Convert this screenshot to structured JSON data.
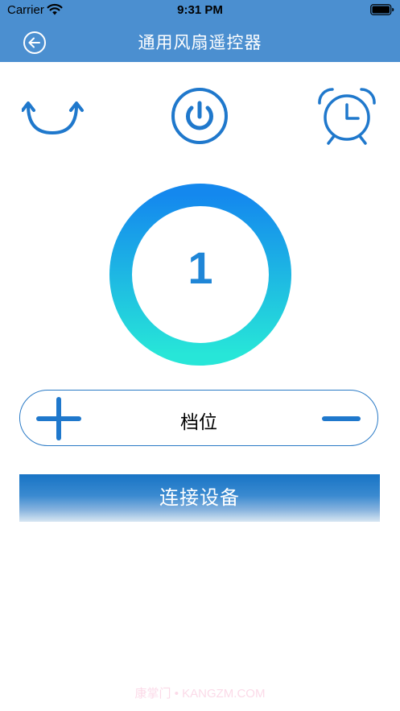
{
  "status_bar": {
    "carrier": "Carrier",
    "time": "9:31 PM"
  },
  "nav": {
    "title": "通用风扇遥控器",
    "back_icon": "back-arrow-circle-icon"
  },
  "controls": {
    "swing_icon": "swing-arrows-icon",
    "power_icon": "power-icon",
    "timer_icon": "alarm-clock-icon"
  },
  "gear": {
    "current_value": "1",
    "label": "档位",
    "plus_icon": "plus-icon",
    "minus_icon": "minus-icon"
  },
  "connect": {
    "label": "连接设备"
  },
  "watermark": "康掌门 • KANGZM.COM",
  "colors": {
    "nav_bar": "#4b8fd0",
    "accent": "#1f86d7",
    "ring_top": "#1488ee",
    "ring_bottom": "#27e6d8"
  }
}
